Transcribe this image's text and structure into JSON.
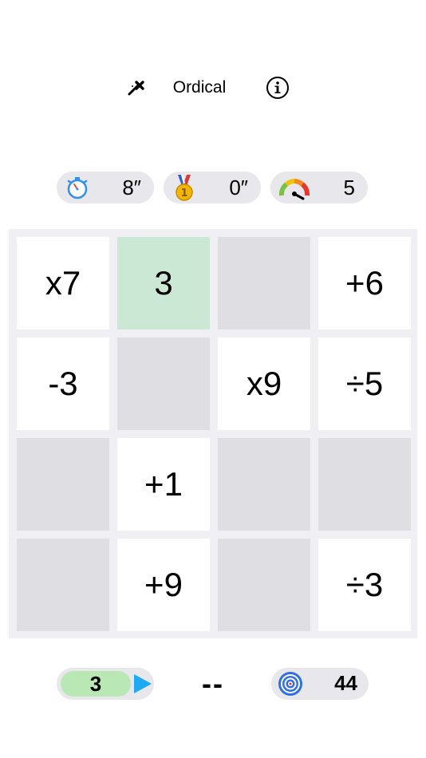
{
  "header": {
    "title": "Ordical",
    "left_icon": "magic-wand-icon",
    "right_icon": "info-icon"
  },
  "stats": {
    "timer": {
      "icon": "stopwatch-icon",
      "value": "8″"
    },
    "best": {
      "icon": "gold-medal-icon",
      "value": "0″"
    },
    "difficulty": {
      "icon": "speedometer-icon",
      "value": "5"
    }
  },
  "board": {
    "rows": [
      [
        {
          "label": "x7",
          "state": "filled"
        },
        {
          "label": "3",
          "state": "selected"
        },
        {
          "label": "",
          "state": "empty"
        },
        {
          "label": "+6",
          "state": "filled"
        }
      ],
      [
        {
          "label": "-3",
          "state": "filled"
        },
        {
          "label": "",
          "state": "empty"
        },
        {
          "label": "x9",
          "state": "filled"
        },
        {
          "label": "÷5",
          "state": "filled"
        }
      ],
      [
        {
          "label": "",
          "state": "empty"
        },
        {
          "label": "+1",
          "state": "filled"
        },
        {
          "label": "",
          "state": "empty"
        },
        {
          "label": "",
          "state": "empty"
        }
      ],
      [
        {
          "label": "",
          "state": "empty"
        },
        {
          "label": "+9",
          "state": "filled"
        },
        {
          "label": "",
          "state": "empty"
        },
        {
          "label": "÷3",
          "state": "filled"
        }
      ]
    ]
  },
  "footer": {
    "current_value": "3",
    "result": "--",
    "target": {
      "icon": "target-icon",
      "value": "44"
    }
  },
  "colors": {
    "selected_cell": "#cbe8d4",
    "empty_cell": "#dedee3",
    "current_value_bg": "#b9e8b4",
    "play_arrow": "#1fa9f2"
  }
}
